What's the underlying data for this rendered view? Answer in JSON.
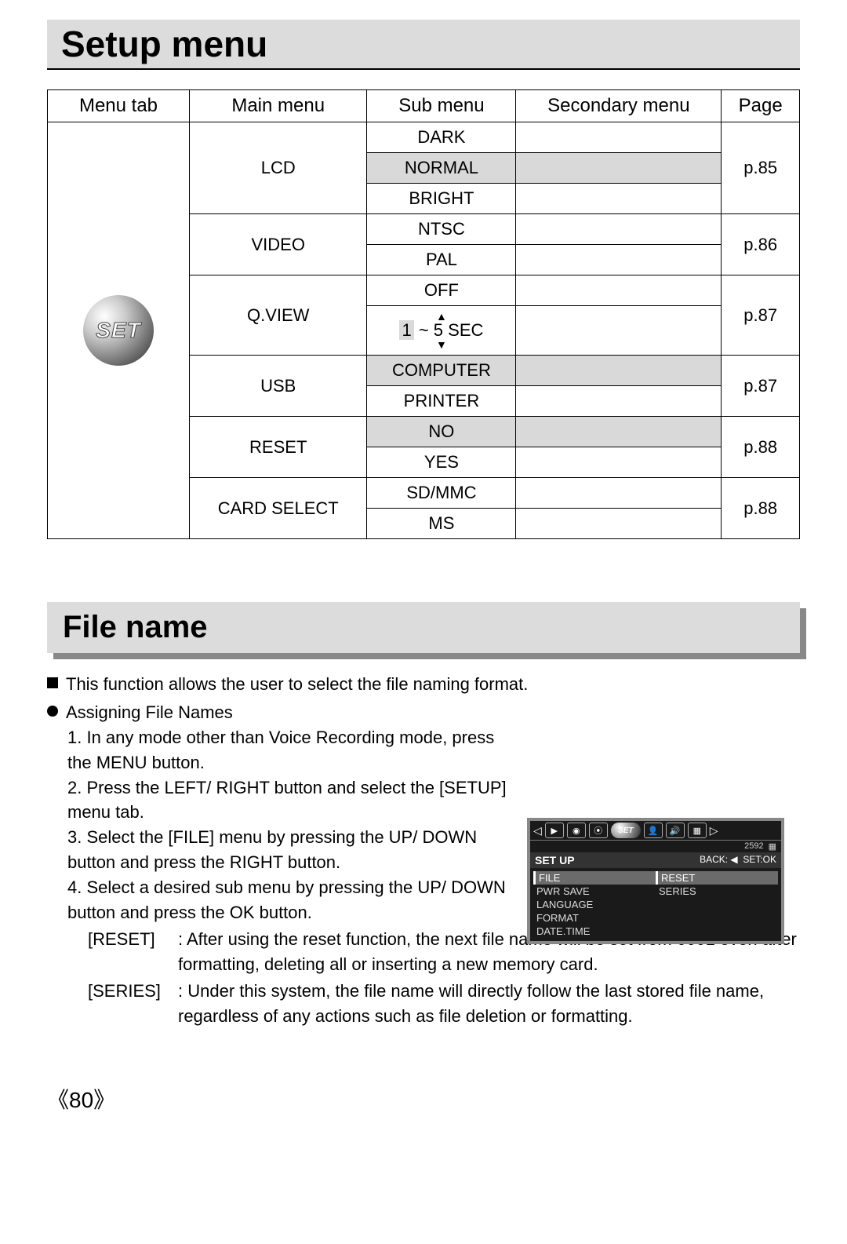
{
  "title": "Setup menu",
  "headers": {
    "menutab": "Menu tab",
    "main": "Main menu",
    "sub": "Sub menu",
    "sec": "Secondary menu",
    "page": "Page"
  },
  "set_label": "SET",
  "rows": {
    "lcd": {
      "label": "LCD",
      "sub": {
        "dark": "DARK",
        "normal": "NORMAL",
        "bright": "BRIGHT"
      },
      "page": "p.85"
    },
    "video": {
      "label": "VIDEO",
      "sub": {
        "ntsc": "NTSC",
        "pal": "PAL"
      },
      "page": "p.86"
    },
    "qview": {
      "label": "Q.VIEW",
      "sub": {
        "off": "OFF",
        "range": "1 ~ 5 SEC",
        "num": "1"
      },
      "page": "p.87"
    },
    "usb": {
      "label": "USB",
      "sub": {
        "computer": "COMPUTER",
        "printer": "PRINTER"
      },
      "page": "p.87"
    },
    "reset": {
      "label": "RESET",
      "sub": {
        "no": "NO",
        "yes": "YES"
      },
      "page": "p.88"
    },
    "card": {
      "label": "CARD SELECT",
      "sub": {
        "sd": "SD/MMC",
        "ms": "MS"
      },
      "page": "p.88"
    }
  },
  "section": "File name",
  "text": {
    "intro": "This function allows the user to select the file naming format.",
    "assign": "Assigning File Names",
    "s1": "1. In any mode other than Voice Recording mode, press the MENU button.",
    "s2": "2. Press the LEFT/ RIGHT button and select the [SETUP] menu tab.",
    "s3": "3. Select the [FILE] menu by pressing the UP/ DOWN button and press the RIGHT button.",
    "s4": "4. Select a desired sub menu by pressing the UP/ DOWN button and press the OK button.",
    "reset_l": "[RESET]",
    "reset_t": ": After using the reset function, the next file name will be set from 0001 even after formatting, deleting all or inserting a new memory card.",
    "series_l": "[SERIES]",
    "series_t": ": Under this system, the file name will directly follow the last stored file name, regardless of any actions such as file deletion or formatting."
  },
  "screen": {
    "num": "2592",
    "title": "SET UP",
    "back": "BACK: ◀",
    "ok": "SET:OK",
    "left": [
      "FILE",
      "PWR SAVE",
      "LANGUAGE",
      "FORMAT",
      "DATE.TIME"
    ],
    "right": [
      "RESET",
      "SERIES"
    ]
  },
  "page_num": "《80》"
}
